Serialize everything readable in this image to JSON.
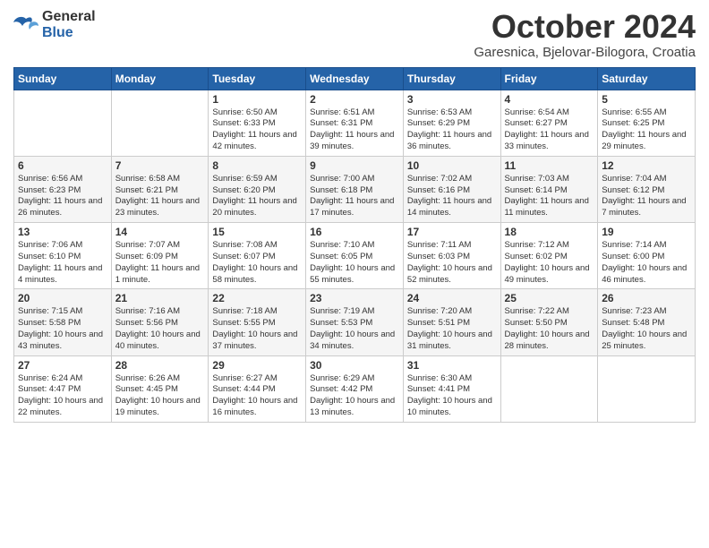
{
  "logo": {
    "general": "General",
    "blue": "Blue"
  },
  "header": {
    "month": "October 2024",
    "location": "Garesnica, Bjelovar-Bilogora, Croatia"
  },
  "weekdays": [
    "Sunday",
    "Monday",
    "Tuesday",
    "Wednesday",
    "Thursday",
    "Friday",
    "Saturday"
  ],
  "weeks": [
    [
      {
        "day": "",
        "sunrise": "",
        "sunset": "",
        "daylight": ""
      },
      {
        "day": "",
        "sunrise": "",
        "sunset": "",
        "daylight": ""
      },
      {
        "day": "1",
        "sunrise": "Sunrise: 6:50 AM",
        "sunset": "Sunset: 6:33 PM",
        "daylight": "Daylight: 11 hours and 42 minutes."
      },
      {
        "day": "2",
        "sunrise": "Sunrise: 6:51 AM",
        "sunset": "Sunset: 6:31 PM",
        "daylight": "Daylight: 11 hours and 39 minutes."
      },
      {
        "day": "3",
        "sunrise": "Sunrise: 6:53 AM",
        "sunset": "Sunset: 6:29 PM",
        "daylight": "Daylight: 11 hours and 36 minutes."
      },
      {
        "day": "4",
        "sunrise": "Sunrise: 6:54 AM",
        "sunset": "Sunset: 6:27 PM",
        "daylight": "Daylight: 11 hours and 33 minutes."
      },
      {
        "day": "5",
        "sunrise": "Sunrise: 6:55 AM",
        "sunset": "Sunset: 6:25 PM",
        "daylight": "Daylight: 11 hours and 29 minutes."
      }
    ],
    [
      {
        "day": "6",
        "sunrise": "Sunrise: 6:56 AM",
        "sunset": "Sunset: 6:23 PM",
        "daylight": "Daylight: 11 hours and 26 minutes."
      },
      {
        "day": "7",
        "sunrise": "Sunrise: 6:58 AM",
        "sunset": "Sunset: 6:21 PM",
        "daylight": "Daylight: 11 hours and 23 minutes."
      },
      {
        "day": "8",
        "sunrise": "Sunrise: 6:59 AM",
        "sunset": "Sunset: 6:20 PM",
        "daylight": "Daylight: 11 hours and 20 minutes."
      },
      {
        "day": "9",
        "sunrise": "Sunrise: 7:00 AM",
        "sunset": "Sunset: 6:18 PM",
        "daylight": "Daylight: 11 hours and 17 minutes."
      },
      {
        "day": "10",
        "sunrise": "Sunrise: 7:02 AM",
        "sunset": "Sunset: 6:16 PM",
        "daylight": "Daylight: 11 hours and 14 minutes."
      },
      {
        "day": "11",
        "sunrise": "Sunrise: 7:03 AM",
        "sunset": "Sunset: 6:14 PM",
        "daylight": "Daylight: 11 hours and 11 minutes."
      },
      {
        "day": "12",
        "sunrise": "Sunrise: 7:04 AM",
        "sunset": "Sunset: 6:12 PM",
        "daylight": "Daylight: 11 hours and 7 minutes."
      }
    ],
    [
      {
        "day": "13",
        "sunrise": "Sunrise: 7:06 AM",
        "sunset": "Sunset: 6:10 PM",
        "daylight": "Daylight: 11 hours and 4 minutes."
      },
      {
        "day": "14",
        "sunrise": "Sunrise: 7:07 AM",
        "sunset": "Sunset: 6:09 PM",
        "daylight": "Daylight: 11 hours and 1 minute."
      },
      {
        "day": "15",
        "sunrise": "Sunrise: 7:08 AM",
        "sunset": "Sunset: 6:07 PM",
        "daylight": "Daylight: 10 hours and 58 minutes."
      },
      {
        "day": "16",
        "sunrise": "Sunrise: 7:10 AM",
        "sunset": "Sunset: 6:05 PM",
        "daylight": "Daylight: 10 hours and 55 minutes."
      },
      {
        "day": "17",
        "sunrise": "Sunrise: 7:11 AM",
        "sunset": "Sunset: 6:03 PM",
        "daylight": "Daylight: 10 hours and 52 minutes."
      },
      {
        "day": "18",
        "sunrise": "Sunrise: 7:12 AM",
        "sunset": "Sunset: 6:02 PM",
        "daylight": "Daylight: 10 hours and 49 minutes."
      },
      {
        "day": "19",
        "sunrise": "Sunrise: 7:14 AM",
        "sunset": "Sunset: 6:00 PM",
        "daylight": "Daylight: 10 hours and 46 minutes."
      }
    ],
    [
      {
        "day": "20",
        "sunrise": "Sunrise: 7:15 AM",
        "sunset": "Sunset: 5:58 PM",
        "daylight": "Daylight: 10 hours and 43 minutes."
      },
      {
        "day": "21",
        "sunrise": "Sunrise: 7:16 AM",
        "sunset": "Sunset: 5:56 PM",
        "daylight": "Daylight: 10 hours and 40 minutes."
      },
      {
        "day": "22",
        "sunrise": "Sunrise: 7:18 AM",
        "sunset": "Sunset: 5:55 PM",
        "daylight": "Daylight: 10 hours and 37 minutes."
      },
      {
        "day": "23",
        "sunrise": "Sunrise: 7:19 AM",
        "sunset": "Sunset: 5:53 PM",
        "daylight": "Daylight: 10 hours and 34 minutes."
      },
      {
        "day": "24",
        "sunrise": "Sunrise: 7:20 AM",
        "sunset": "Sunset: 5:51 PM",
        "daylight": "Daylight: 10 hours and 31 minutes."
      },
      {
        "day": "25",
        "sunrise": "Sunrise: 7:22 AM",
        "sunset": "Sunset: 5:50 PM",
        "daylight": "Daylight: 10 hours and 28 minutes."
      },
      {
        "day": "26",
        "sunrise": "Sunrise: 7:23 AM",
        "sunset": "Sunset: 5:48 PM",
        "daylight": "Daylight: 10 hours and 25 minutes."
      }
    ],
    [
      {
        "day": "27",
        "sunrise": "Sunrise: 6:24 AM",
        "sunset": "Sunset: 4:47 PM",
        "daylight": "Daylight: 10 hours and 22 minutes."
      },
      {
        "day": "28",
        "sunrise": "Sunrise: 6:26 AM",
        "sunset": "Sunset: 4:45 PM",
        "daylight": "Daylight: 10 hours and 19 minutes."
      },
      {
        "day": "29",
        "sunrise": "Sunrise: 6:27 AM",
        "sunset": "Sunset: 4:44 PM",
        "daylight": "Daylight: 10 hours and 16 minutes."
      },
      {
        "day": "30",
        "sunrise": "Sunrise: 6:29 AM",
        "sunset": "Sunset: 4:42 PM",
        "daylight": "Daylight: 10 hours and 13 minutes."
      },
      {
        "day": "31",
        "sunrise": "Sunrise: 6:30 AM",
        "sunset": "Sunset: 4:41 PM",
        "daylight": "Daylight: 10 hours and 10 minutes."
      },
      {
        "day": "",
        "sunrise": "",
        "sunset": "",
        "daylight": ""
      },
      {
        "day": "",
        "sunrise": "",
        "sunset": "",
        "daylight": ""
      }
    ]
  ]
}
